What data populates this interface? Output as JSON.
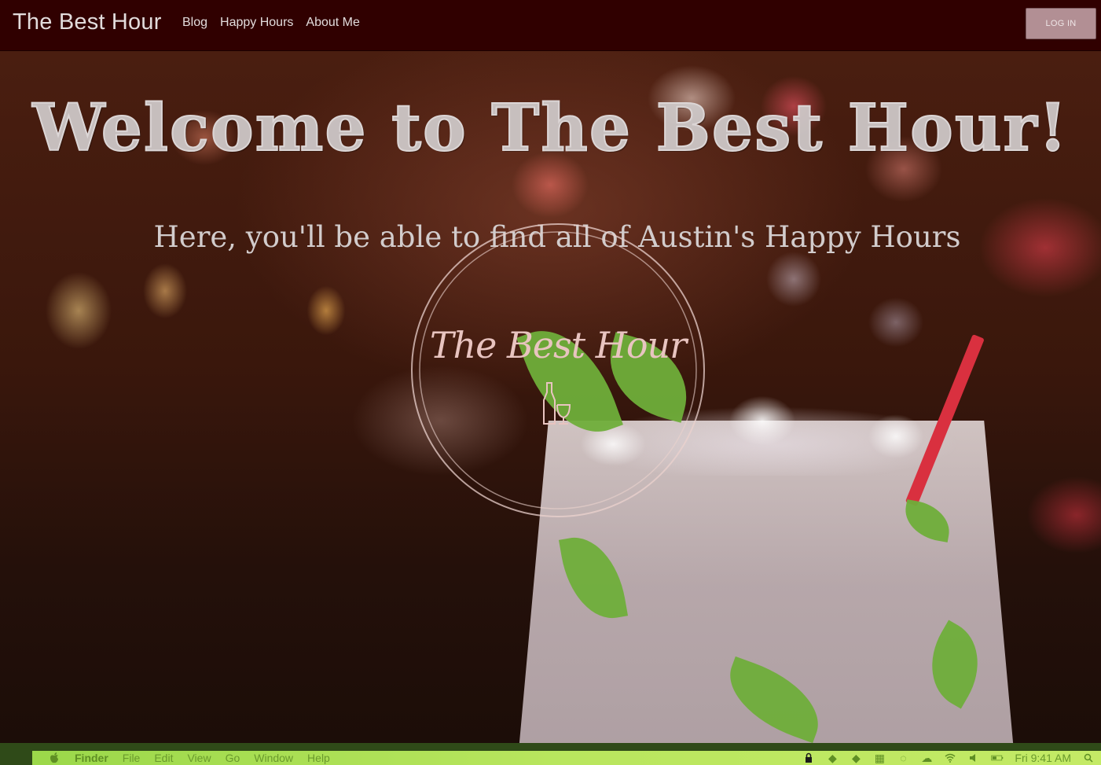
{
  "navbar": {
    "brand": "The Best Hour",
    "links": [
      "Blog",
      "Happy Hours",
      "About Me"
    ],
    "login_label": "LOG IN"
  },
  "hero": {
    "title": "Welcome to The Best Hour!",
    "subtitle": "Here, you'll be able to find all of Austin's Happy Hours",
    "logo_text": "The Best Hour"
  },
  "menubar": {
    "app": "Finder",
    "items": [
      "File",
      "Edit",
      "View",
      "Go",
      "Window",
      "Help"
    ],
    "clock": "Fri 9:41 AM"
  },
  "colors": {
    "navbar_bg": "#300000",
    "login_bg": "#b28f94",
    "menubar": "#b9e65e"
  },
  "icons": [
    "apple-icon",
    "lock-icon",
    "wifi-icon",
    "volume-icon",
    "battery-icon",
    "spotlight-icon",
    "bottle-glass-icon"
  ]
}
